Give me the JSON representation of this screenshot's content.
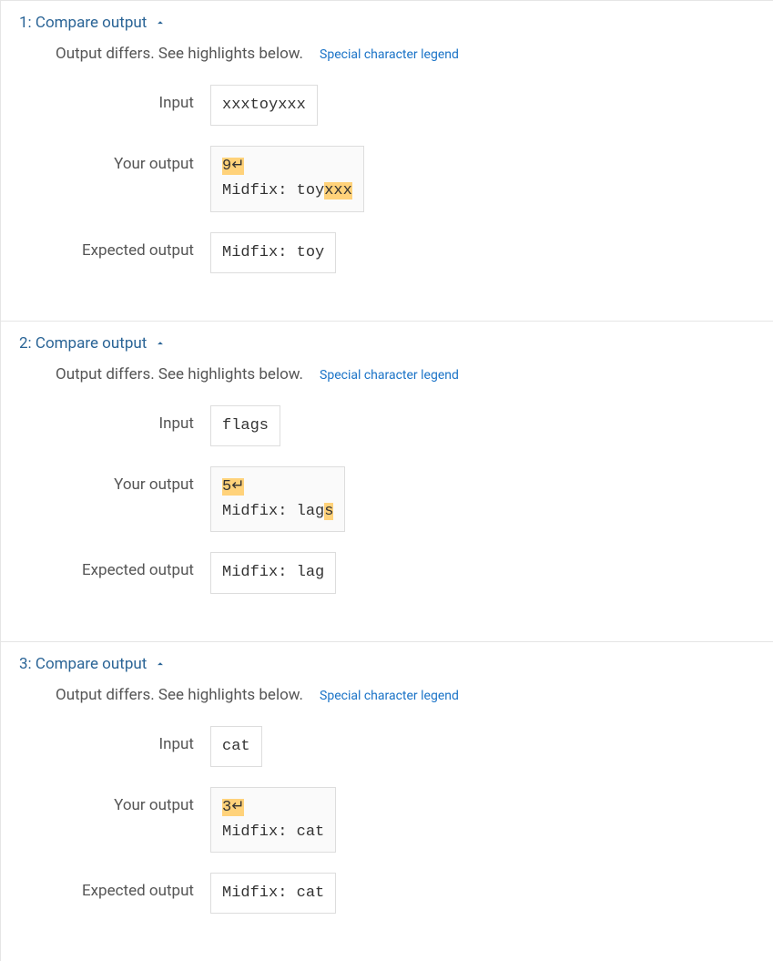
{
  "labels": {
    "diff_summary": "Output differs. See highlights below.",
    "legend": "Special character legend",
    "input": "Input",
    "your_output": "Your output",
    "expected_output": "Expected output",
    "compare_output": "Compare output"
  },
  "newline_symbol": "↵",
  "tests": [
    {
      "index": "1",
      "input": "xxxtoyxxx",
      "your_output": {
        "segments": [
          {
            "t": "9",
            "hl": true
          },
          {
            "t": "↵",
            "hl": true,
            "nl": true
          },
          {
            "t": "\n",
            "hl": false
          },
          {
            "t": "Midfix: toy",
            "hl": false
          },
          {
            "t": "xxx",
            "hl": true
          }
        ]
      },
      "expected_output": "Midfix: toy"
    },
    {
      "index": "2",
      "input": "flags",
      "your_output": {
        "segments": [
          {
            "t": "5",
            "hl": true
          },
          {
            "t": "↵",
            "hl": true,
            "nl": true
          },
          {
            "t": "\n",
            "hl": false
          },
          {
            "t": "Midfix: lag",
            "hl": false
          },
          {
            "t": "s",
            "hl": true
          }
        ]
      },
      "expected_output": "Midfix: lag"
    },
    {
      "index": "3",
      "input": "cat",
      "your_output": {
        "segments": [
          {
            "t": "3",
            "hl": true
          },
          {
            "t": "↵",
            "hl": true,
            "nl": true
          },
          {
            "t": "\n",
            "hl": false
          },
          {
            "t": "Midfix: cat",
            "hl": false
          }
        ]
      },
      "expected_output": "Midfix: cat"
    }
  ]
}
